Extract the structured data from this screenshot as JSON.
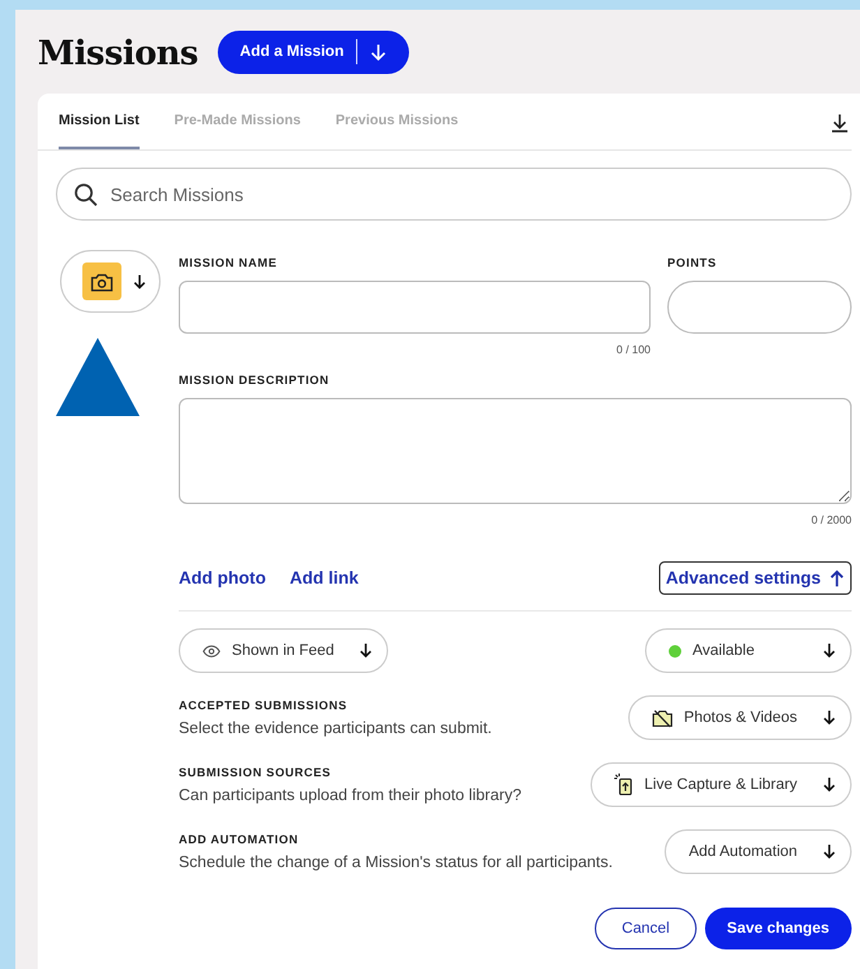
{
  "title": "Missions",
  "add_button": {
    "label": "Add a Mission"
  },
  "tabs": [
    {
      "label": "Mission List",
      "selected": true
    },
    {
      "label": "Pre-Made Missions",
      "selected": false
    },
    {
      "label": "Previous Missions",
      "selected": false
    }
  ],
  "search": {
    "placeholder": "Search Missions"
  },
  "form": {
    "name_label": "MISSION NAME",
    "name_counter": "0 / 100",
    "points_label": "POINTS",
    "description_label": "MISSION DESCRIPTION",
    "description_counter": "0 / 2000"
  },
  "links": [
    "Add photo",
    "Add link"
  ],
  "advanced_settings": {
    "label": "Advanced settings",
    "expanded": true
  },
  "visibility": {
    "label": "Shown in Feed"
  },
  "status": {
    "label": "Available",
    "color": "#5fd03a"
  },
  "settings": [
    {
      "heading": "ACCEPTED SUBMISSIONS",
      "description": "Select the evidence participants can submit.",
      "control": "Photos & Videos",
      "kind": "camera-off"
    },
    {
      "heading": "SUBMISSION SOURCES",
      "description": "Can participants upload from their photo library?",
      "control": "Live Capture & Library",
      "kind": "phone-upload"
    },
    {
      "heading": "ADD AUTOMATION",
      "description": "Schedule the change of a Mission's status for all participants.",
      "control": "Add Automation"
    }
  ],
  "buttons": {
    "cancel": "Cancel",
    "save": "Save changes"
  }
}
